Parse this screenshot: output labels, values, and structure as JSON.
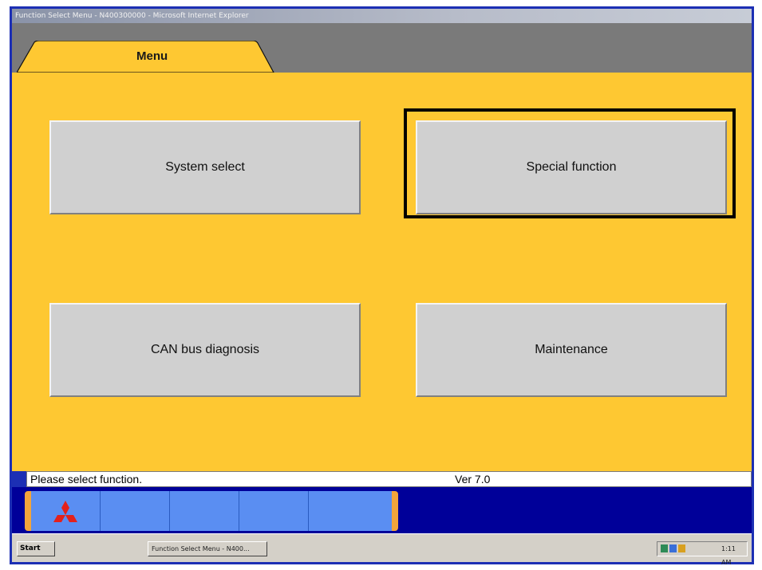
{
  "window": {
    "title": "Function Select Menu - N400300000 - Microsoft Internet Explorer"
  },
  "tab": {
    "label": "Menu"
  },
  "menu": {
    "buttons": [
      {
        "label": "System select",
        "focused": false
      },
      {
        "label": "Special function",
        "focused": true
      },
      {
        "label": "CAN bus diagnosis",
        "focused": false
      },
      {
        "label": "Maintenance",
        "focused": false
      }
    ]
  },
  "status": {
    "message": "Please select function.",
    "version": "Ver 7.0"
  },
  "toolbar": {
    "buttons": [
      {
        "icon": "mitsubishi-logo-icon"
      },
      {
        "icon": ""
      },
      {
        "icon": ""
      },
      {
        "icon": ""
      },
      {
        "icon": ""
      }
    ]
  },
  "taskbar": {
    "start_label": "Start",
    "task_label": "Function Select Menu - N400...",
    "clock": "1:11 AM"
  },
  "colors": {
    "background": "#fec832",
    "tab_bar": "#7a7a7a",
    "toolbar_blue": "#5a8ef2",
    "bottom_bar": "#000099",
    "button_gray": "#d0d0d0",
    "mitsubishi_red": "#e3211c"
  }
}
